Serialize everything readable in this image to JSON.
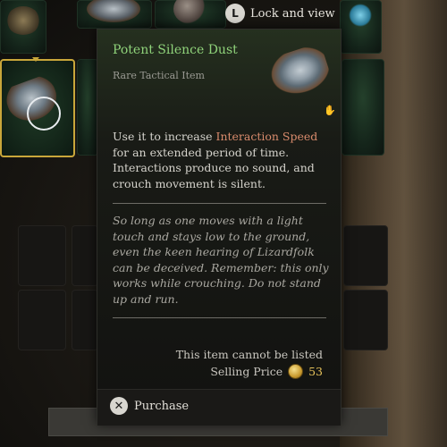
{
  "header": {
    "lock_label": "Lock and view",
    "lock_icon_glyph": "L"
  },
  "tooltip": {
    "title": "Potent Silence Dust",
    "rarity": "Rare Tactical Item",
    "description_prefix": "Use it to increase ",
    "description_highlight": "Interaction Speed",
    "description_suffix": " for an extended period of time. Interactions produce no sound, and crouch movement is silent.",
    "lore": "So long as one moves with a light touch and stays low to the ground, even the keen hearing of Lizardfolk can be deceived. Remember: this only works while crouching. Do not stand up and run.",
    "list_note": "This item cannot be listed",
    "selling_label": "Selling Price",
    "selling_price": "53",
    "purchase_label": "Purchase",
    "purchase_icon_glyph": "✕"
  },
  "colors": {
    "title": "#8fd27a",
    "highlight": "#d98b6c",
    "price": "#e6c25a",
    "selected_border": "#c9a63a"
  },
  "icons": {
    "lock": "lock-view-button-icon",
    "purchase": "x-button-icon",
    "coin": "gold-coin-icon",
    "interaction": "hands-icon"
  }
}
